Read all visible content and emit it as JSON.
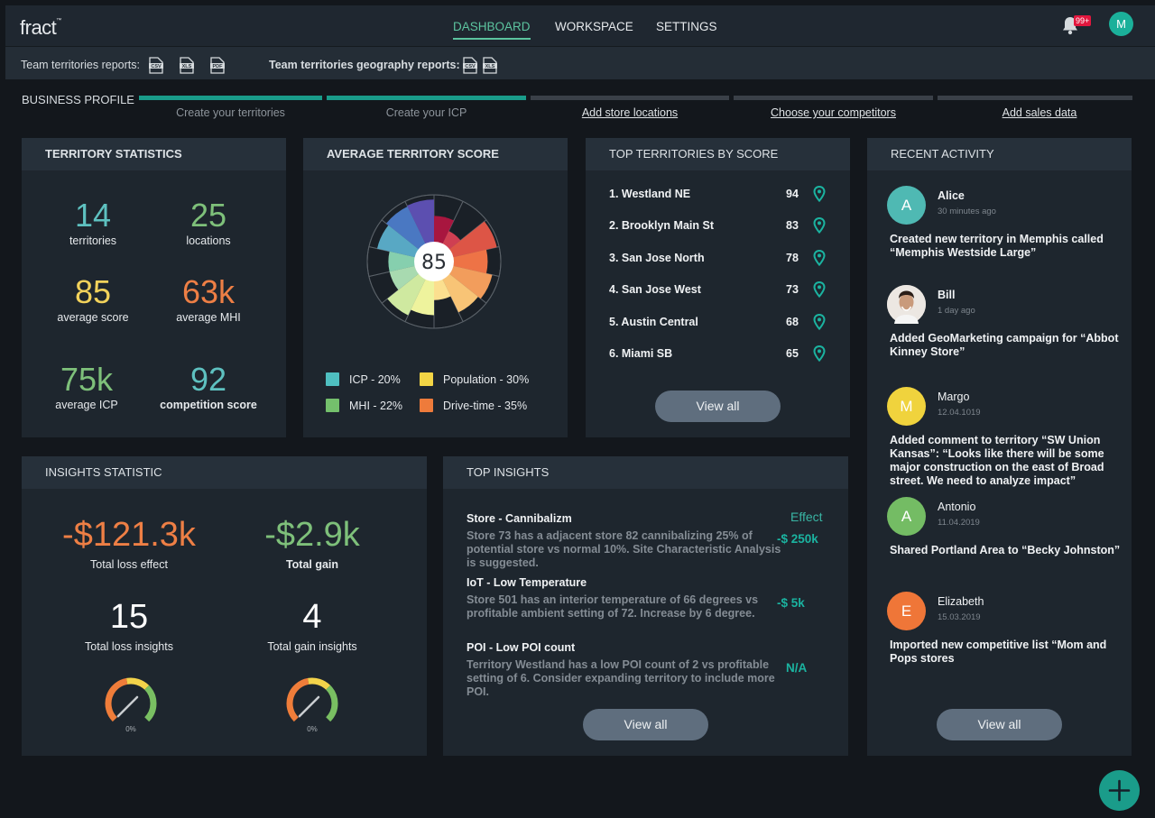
{
  "app": {
    "logo": "fract",
    "logo_tm": "™"
  },
  "nav": {
    "items": [
      {
        "label": "DASHBOARD",
        "active": true
      },
      {
        "label": "WORKSPACE",
        "active": false
      },
      {
        "label": "SETTINGS",
        "active": false
      }
    ],
    "notification_badge": "99+",
    "user_initial": "M",
    "user_color": "#1bb09a"
  },
  "reports": {
    "team_label": "Team territories reports:",
    "team_files": [
      "CSV",
      "XLS",
      "PDF"
    ],
    "geo_label": "Team territories geography reports:",
    "geo_files": [
      "CSV",
      "XLS"
    ]
  },
  "business_profile": {
    "label": "BUSINESS PROFILE",
    "steps": [
      {
        "label": "Create your territories",
        "done": true
      },
      {
        "label": "Create your ICP",
        "done": true
      },
      {
        "label": "Add store locations",
        "done": false
      },
      {
        "label": "Choose your competitors",
        "done": false
      },
      {
        "label": "Add sales data",
        "done": false
      }
    ]
  },
  "territory_statistics": {
    "title": "TERRITORY STATISTICS",
    "stats": [
      {
        "value": "14",
        "label": "territories",
        "color": "#5ec1c0"
      },
      {
        "value": "25",
        "label": "locations",
        "color": "#7ec07a"
      },
      {
        "value": "85",
        "label": "average score",
        "color": "#f2d25b"
      },
      {
        "value": "63k",
        "label": "average MHI",
        "color": "#ee7f45"
      },
      {
        "value": "75k",
        "label": "average ICP",
        "color": "#7ec07a"
      },
      {
        "value": "92",
        "label": "competition score",
        "color": "#5ec1c0"
      }
    ]
  },
  "average_score": {
    "title": "AVERAGE TERRITORY SCORE",
    "center_value": "85",
    "legend": [
      {
        "label": "ICP - 20%",
        "color": "#4fbfc0"
      },
      {
        "label": "Population - 30%",
        "color": "#f3d545"
      },
      {
        "label": "MHI - 22%",
        "color": "#74c06c"
      },
      {
        "label": "Drive-time - 35%",
        "color": "#ee7b3b"
      }
    ]
  },
  "chart_data": {
    "type": "polar-area",
    "title": "AVERAGE TERRITORY SCORE",
    "center_label": "85",
    "segments": [
      {
        "value": 0.55,
        "color": "#a8163f"
      },
      {
        "value": 0.3,
        "color": "#cf3f52"
      },
      {
        "value": 0.95,
        "color": "#dd5546"
      },
      {
        "value": 0.72,
        "color": "#ee7346"
      },
      {
        "value": 0.85,
        "color": "#f29d5c"
      },
      {
        "value": 0.78,
        "color": "#f8c476"
      },
      {
        "value": 0.4,
        "color": "#fbdf8f"
      },
      {
        "value": 0.72,
        "color": "#eef39d"
      },
      {
        "value": 0.85,
        "color": "#cfe9a0"
      },
      {
        "value": 0.55,
        "color": "#a8dab0"
      },
      {
        "value": 0.55,
        "color": "#86cfae"
      },
      {
        "value": 0.82,
        "color": "#58a8c4"
      },
      {
        "value": 0.88,
        "color": "#4a78c2"
      },
      {
        "value": 0.9,
        "color": "#5c4fb0"
      }
    ],
    "range": [
      0,
      1
    ]
  },
  "top_territories": {
    "title": "TOP TERRITORIES BY SCORE",
    "rows": [
      {
        "name": "1. Westland NE",
        "score": "94"
      },
      {
        "name": "2. Brooklyn Main St",
        "score": "83"
      },
      {
        "name": "3. San Jose North",
        "score": "78"
      },
      {
        "name": "4. San Jose West",
        "score": "73"
      },
      {
        "name": "5. Austin Central",
        "score": "68"
      },
      {
        "name": "6. Miami SB",
        "score": "65"
      }
    ],
    "view_all": "View all"
  },
  "recent_activity": {
    "title": "RECENT ACTIVITY",
    "items": [
      {
        "initial": "A",
        "color": "#4fb9b3",
        "name": "Alice",
        "time": "30 minutes ago",
        "text": "Created new territory in Memphis called “Memphis Westside Large”"
      },
      {
        "initial": "",
        "color": "#e9e4df",
        "name": "Bill",
        "time": "1 day ago",
        "text": "Added GeoMarketing campaign for “Abbot Kinney Store”"
      },
      {
        "initial": "M",
        "color": "#f0d33d",
        "name": "Margo",
        "time": "12.04.1019",
        "text": "Added comment to territory “SW Union Kansas”: “Looks like there will be some major construction on the east of Broad street.  We need to analyze impact”"
      },
      {
        "initial": "A",
        "color": "#74bc64",
        "name": "Antonio",
        "time": "11.04.2019",
        "text": "Shared Portland Area to “Becky Johnston”"
      },
      {
        "initial": "E",
        "color": "#ef7638",
        "name": "Elizabeth",
        "time": "15.03.2019",
        "text": "Imported new competitive list “Mom and Pops stores"
      }
    ],
    "view_all": "View all"
  },
  "insights_statistic": {
    "title": "INSIGHTS STATISTIC",
    "stats": [
      {
        "value": "-$121.3k",
        "label": "Total loss effect",
        "color": "#ee7f45"
      },
      {
        "value": "-$2.9k",
        "label": "Total gain",
        "color": "#7ec07a"
      },
      {
        "value": "15",
        "label": "Total loss insights",
        "color": "#ffffff"
      },
      {
        "value": "4",
        "label": "Total gain insights",
        "color": "#ffffff"
      }
    ],
    "gauges": [
      {
        "label": "0%",
        "value": 0
      },
      {
        "label": "0%",
        "value": 0
      }
    ]
  },
  "top_insights": {
    "title": "TOP INSIGHTS",
    "effect_header": "Effect",
    "items": [
      {
        "title": "Store - Cannibalizm",
        "desc": "Store 73 has a adjacent store 82 cannibalizing 25% of potential store vs normal 10%.  Site Characteristic Analysis is suggested.",
        "effect": "-$ 250k"
      },
      {
        "title": "IoT - Low Temperature",
        "desc": "Store 501 has an interior temperature of 66 degrees vs profitable ambient setting of 72.  Increase by 6 degree.",
        "effect": "-$ 5k"
      },
      {
        "title": "POI - Low POI count",
        "desc": "Territory Westland has a low POI count of 2 vs profitable setting of 6.  Consider expanding territory to include more POI.",
        "effect": "N/A"
      }
    ],
    "view_all": "View all"
  },
  "fab": {
    "icon": "plus-icon"
  }
}
